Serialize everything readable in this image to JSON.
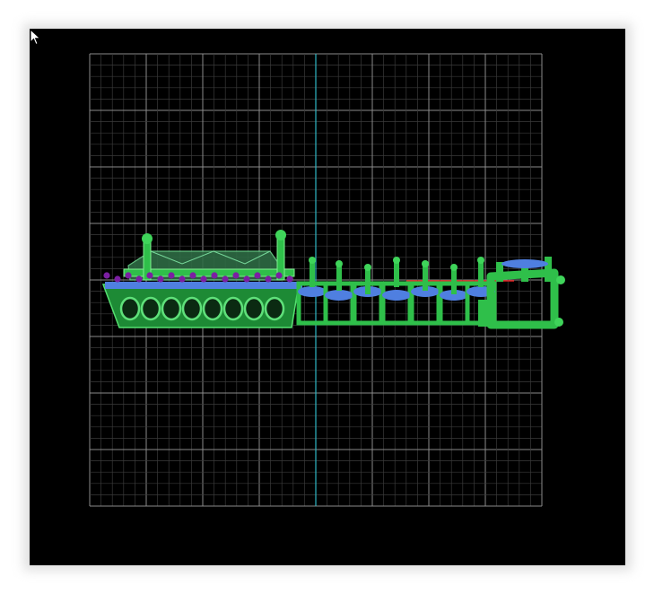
{
  "viewport": {
    "view": "front",
    "background_color": "#000000",
    "grid_color": "#7a7a7a",
    "axis_color": "#2fb7c4",
    "secondary_axis_color": "#e02020"
  },
  "model": {
    "metal_color": "#2fbf4a",
    "gem_color": "#4f7fe0",
    "bead_color": "#7b1fa2",
    "center_stone_color": "#5aa86a"
  },
  "cursor": {
    "icon": "arrow-cursor-icon"
  }
}
